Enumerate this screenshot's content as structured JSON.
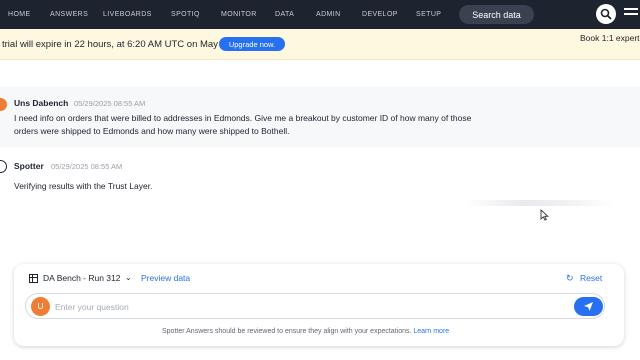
{
  "nav": {
    "items": [
      "HOME",
      "ANSWERS",
      "LIVEBOARDS",
      "SPOTIQ",
      "MONITOR",
      "DATA",
      "ADMIN",
      "DEVELOP",
      "SETUP"
    ],
    "search_label": "Search data"
  },
  "banner": {
    "text": "trial will expire in 22 hours, at 6:20 AM UTC on May 30.",
    "upgrade_label": "Upgrade now.",
    "book_label": "Book 1:1 expert"
  },
  "conversation": {
    "user": {
      "name": "Uns Dabench",
      "time": "05/29/2025 08:55 AM",
      "message": "I need info on orders that were billed to addresses in Edmonds. Give me a breakout by customer ID of how many of those orders were shipped to Edmonds and how many were shipped to Bothell."
    },
    "spotter": {
      "name": "Spotter",
      "time": "05/29/2025 08:55 AM",
      "message": "Verifying results with the Trust Layer."
    }
  },
  "panel": {
    "datasource": "DA Bench - Run 312",
    "preview_label": "Preview data",
    "reset_label": "Reset",
    "avatar_initial": "U",
    "input_placeholder": "Enter your question",
    "disclaimer": "Spotter Answers should be reviewed to ensure they align with your expectations.",
    "learn_more": "Learn more"
  },
  "colors": {
    "nav_bg": "#1d232f",
    "accent": "#2770ef",
    "avatar": "#f07d35",
    "banner_bg": "#fff8e1"
  }
}
